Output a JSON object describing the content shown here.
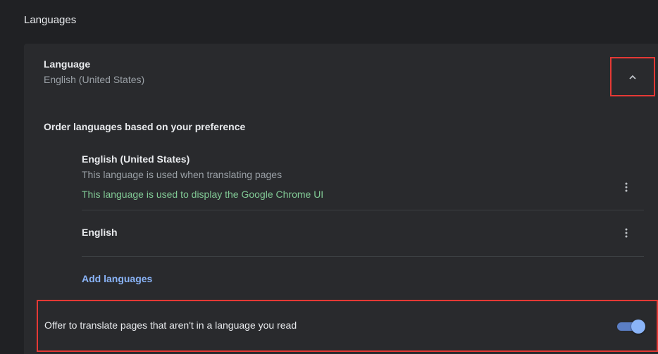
{
  "section": {
    "title": "Languages"
  },
  "language_header": {
    "label": "Language",
    "current": "English (United States)"
  },
  "order": {
    "label": "Order languages based on your preference",
    "items": [
      {
        "name": "English (United States)",
        "note": "This language is used when translating pages",
        "ui_note": "This language is used to display the Google Chrome UI"
      },
      {
        "name": "English"
      }
    ],
    "add_label": "Add languages"
  },
  "offer_translate": {
    "label": "Offer to translate pages that aren't in a language you read",
    "enabled": true
  },
  "icons": {
    "expand": "chevron-up-icon",
    "more": "more-vert-icon"
  },
  "colors": {
    "background": "#202124",
    "card": "#292a2d",
    "accent": "#8ab4f8",
    "ui_note": "#81c995",
    "highlight": "#e53935"
  }
}
